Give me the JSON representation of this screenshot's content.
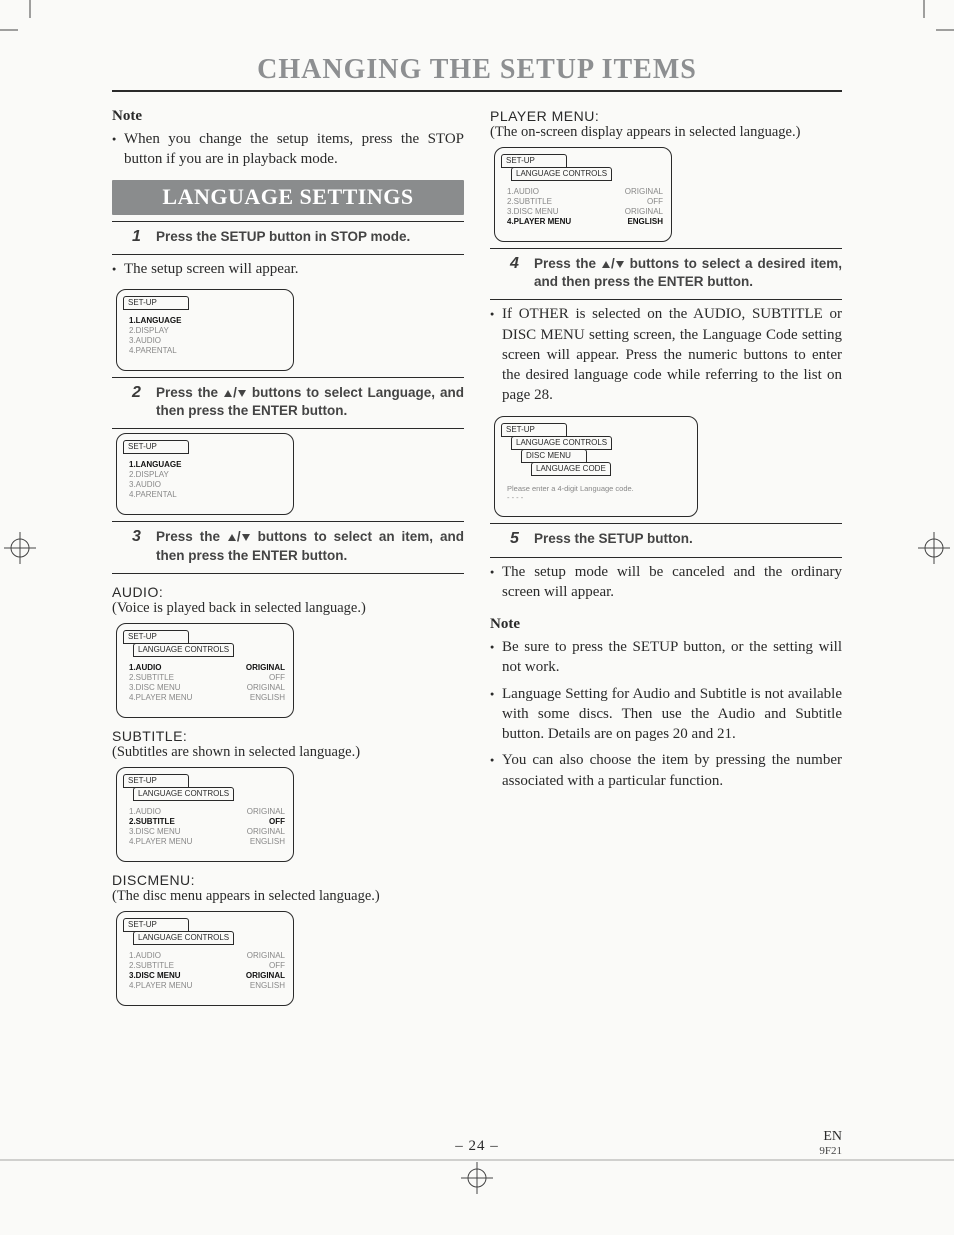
{
  "title": "CHANGING THE SETUP ITEMS",
  "left": {
    "note_head": "Note",
    "note_items": [
      "When you change the setup items, press the STOP button if you are in playback mode."
    ],
    "banner": "LANGUAGE SETTINGS",
    "step1": {
      "num": "1",
      "txt": "Press the SETUP button in STOP mode."
    },
    "step1_after": [
      "The setup screen will appear."
    ],
    "step2": {
      "num": "2",
      "txt": "Press the ▲/▼ buttons to select Language, and then press the ENTER button."
    },
    "step3": {
      "num": "3",
      "txt": "Press the ▲/▼ buttons to select an item, and then press the ENTER button."
    },
    "audio_head": "AUDIO:",
    "audio_desc": "(Voice is played back in selected language.)",
    "subtitle_head": "SUBTITLE:",
    "subtitle_desc": "(Subtitles are shown in selected language.)",
    "discmenu_head": "DISCMENU:",
    "discmenu_desc": "(The disc menu appears in selected language.)"
  },
  "right": {
    "player_head": "PLAYER MENU:",
    "player_desc": "(The on-screen display appears in selected language.)",
    "step4": {
      "num": "4",
      "txt": "Press the ▲/▼ buttons to select a desired item, and then press the ENTER button."
    },
    "step4_after": [
      "If OTHER is selected on the AUDIO, SUBTITLE or DISC MENU setting screen, the Language Code setting screen will appear. Press the numeric buttons to enter the desired language code while referring to the list on page 28."
    ],
    "step5": {
      "num": "5",
      "txt": "Press the SETUP button."
    },
    "step5_after": [
      "The setup mode will be canceled and the ordinary screen will appear."
    ],
    "note_head": "Note",
    "note_items": [
      "Be sure to press the SETUP button, or the setting will not work.",
      "Language Setting for Audio and Subtitle is not available with some discs. Then use the Audio and Subtitle button. Details are on pages 20 and 21.",
      "You can also choose the item by pressing the number associated with a particular function."
    ]
  },
  "osd": {
    "setup": "SET-UP",
    "langctrl": "LANGUAGE CONTROLS",
    "discmenu": "DISC MENU",
    "langcode": "LANGUAGE CODE",
    "code_msg": "Please enter a 4-digit Language code.",
    "code_dashes": "- - - -",
    "main_items": [
      {
        "l": "1.LANGUAGE",
        "sel": true
      },
      {
        "l": "2.DISPLAY",
        "sel": false
      },
      {
        "l": "3.AUDIO",
        "sel": false
      },
      {
        "l": "4.PARENTAL",
        "sel": false
      }
    ],
    "lang_rows": [
      {
        "l": "1.AUDIO",
        "r": "ORIGINAL"
      },
      {
        "l": "2.SUBTITLE",
        "r": "OFF"
      },
      {
        "l": "3.DISC MENU",
        "r": "ORIGINAL"
      },
      {
        "l": "4.PLAYER MENU",
        "r": "ENGLISH"
      }
    ],
    "sel_audio": 0,
    "sel_subtitle": 1,
    "sel_discmenu": 2,
    "sel_player": 3
  },
  "footer": {
    "page": "– 24 –",
    "lang": "EN",
    "code": "9F21"
  }
}
